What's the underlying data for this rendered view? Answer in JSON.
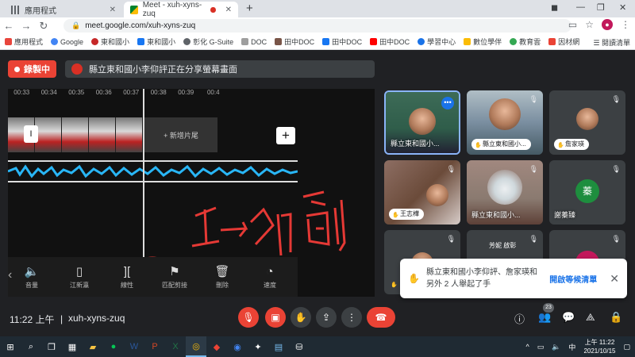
{
  "browser": {
    "tabs": [
      {
        "title": "應用程式",
        "active": false
      },
      {
        "title": "Meet - xuh-xyns-zuq",
        "active": true
      }
    ],
    "url": "meet.google.com/xuh-xyns-zuq",
    "profile_initial": "●",
    "bookmarks": [
      {
        "label": "應用程式",
        "color": "#e8453c"
      },
      {
        "label": "Google",
        "color": "#4285f4"
      },
      {
        "label": "東和國小",
        "color": "#c62828"
      },
      {
        "label": "東和國小",
        "color": "#1877f2"
      },
      {
        "label": "彰化 G-Suite",
        "color": "#5f6368"
      },
      {
        "label": "DOC",
        "color": "#9e9e9e"
      },
      {
        "label": "田中DOC",
        "color": "#795548"
      },
      {
        "label": "田中DOC",
        "color": "#1877f2"
      },
      {
        "label": "田中DOC",
        "color": "#ff0000"
      },
      {
        "label": "學習中心",
        "color": "#1a73e8"
      },
      {
        "label": "數位學伴",
        "color": "#fbbc05"
      },
      {
        "label": "教育雲",
        "color": "#34a853"
      },
      {
        "label": "因材網",
        "color": "#ea4335"
      }
    ],
    "reading_list": "閱讀清單"
  },
  "meet": {
    "recording_label": "錄製中",
    "share_banner": "縣立東和國小李仰評正在分享螢幕畫面",
    "shared_screen": {
      "ruler_ticks": [
        "00:33",
        "00:34",
        "00:35",
        "00:36",
        "00:37",
        "00:38",
        "00:39",
        "00:4"
      ],
      "add_clip_label": "+ 新增片尾",
      "clip_handle": "I",
      "plus": "+",
      "tools": [
        {
          "icon": "🔈",
          "label": "音量"
        },
        {
          "icon": "▯",
          "label": "江新瀛"
        },
        {
          "icon": "][",
          "label": "線性"
        },
        {
          "icon": "⚑",
          "label": "匹配剪接"
        },
        {
          "icon": "🗑",
          "label": "刪除"
        },
        {
          "icon": "◔",
          "label": "速度"
        }
      ],
      "handwriting": "工→ 分割",
      "back_chevron": "‹"
    },
    "participants": [
      {
        "name": "縣立東和國小...",
        "style": "photo",
        "bg": "#2f5d4a"
      },
      {
        "name": "縣立東和國小...",
        "style": "photo-pill",
        "bg": "#7a8ea0"
      },
      {
        "name": "詹家瑛",
        "style": "avatar-pill",
        "bg": "#3c4043"
      },
      {
        "name": "王志樺",
        "style": "photo-pill",
        "bg": "#6b4b3a"
      },
      {
        "name": "縣立東和國小...",
        "style": "photo",
        "bg": "#8a7a70"
      },
      {
        "name": "謝蓁臻",
        "initial": "蓁",
        "avatar_color": "#1e8e3e",
        "style": "initial",
        "bg": "#3c4043"
      },
      {
        "name": "",
        "style": "photo-hand",
        "bg": "#3c4043"
      },
      {
        "name": "",
        "initial": "芳妮 啟彰",
        "style": "pair",
        "bg": "#3c4043"
      },
      {
        "name": "",
        "style": "avatar-pink",
        "bg": "#3c4043"
      }
    ],
    "toast": {
      "text": "縣立東和國小李仰評、詹家瑛和另外 2 人舉起了手",
      "action": "開啟等候清單",
      "close": "✕"
    }
  },
  "bottombar": {
    "time": "11:22 上午",
    "separator": "|",
    "meeting_code": "xuh-xyns-zuq",
    "participant_count": "23",
    "controls": [
      "mic-off",
      "camera-off",
      "raise-hand",
      "present",
      "more",
      "end-call"
    ],
    "right_controls": [
      "info",
      "people",
      "chat",
      "activities",
      "host-controls"
    ]
  },
  "taskbar": {
    "tray_time": "上午 11:22",
    "tray_date": "2021/10/15"
  }
}
